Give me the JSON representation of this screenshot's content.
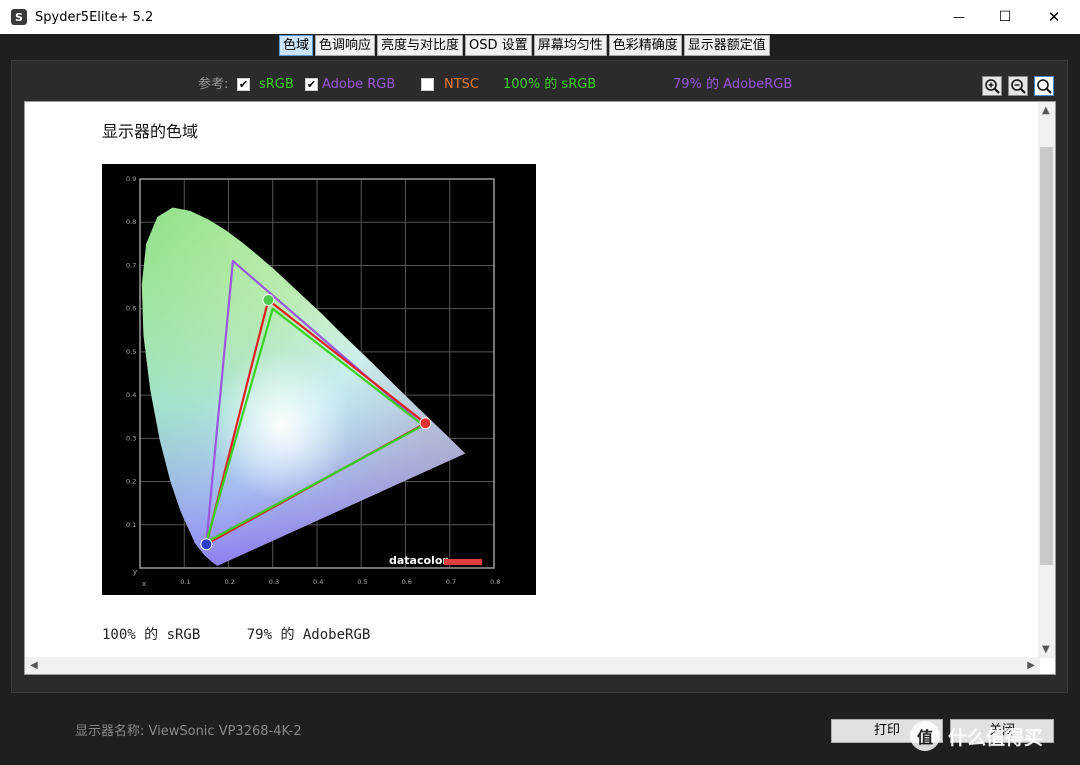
{
  "window": {
    "title": "Spyder5Elite+ 5.2",
    "app_icon": "S",
    "controls": {
      "minimize": "—",
      "maximize": "☐",
      "close": "✕"
    }
  },
  "tabs": [
    {
      "label": "色域",
      "active": true
    },
    {
      "label": "色调响应",
      "active": false
    },
    {
      "label": "亮度与对比度",
      "active": false
    },
    {
      "label": "OSD 设置",
      "active": false
    },
    {
      "label": "屏幕均匀性",
      "active": false
    },
    {
      "label": "色彩精确度",
      "active": false
    },
    {
      "label": "显示器额定值",
      "active": false
    }
  ],
  "reference": {
    "label": "参考:",
    "options": [
      {
        "label": "sRGB",
        "checked": true,
        "color": "#39d11f"
      },
      {
        "label": "Adobe RGB",
        "checked": true,
        "color": "#9a56e0"
      },
      {
        "label": "NTSC",
        "checked": false,
        "color": "#f07a2a"
      }
    ],
    "summary_srgb": "100% 的 sRGB",
    "summary_adobe": "79% 的 AdobeRGB",
    "summary_srgb_color": "#39d11f",
    "summary_adobe_color": "#9a56e0"
  },
  "zoom": {
    "zoom_in_icon": "zoom-in-icon",
    "zoom_out_icon": "zoom-out-icon",
    "zoom_fit_icon": "zoom-fit-icon"
  },
  "report": {
    "title": "显示器的色域",
    "result_srgb": "100% 的 sRGB",
    "result_adobe": "79% 的 AdobeRGB"
  },
  "chart": {
    "logo": "datacolor",
    "x_axis_label": "x",
    "y_axis_label": "y",
    "x_ticks": [
      "0.1",
      "0.2",
      "0.3",
      "0.4",
      "0.5",
      "0.6",
      "0.7",
      "0.8"
    ],
    "y_ticks": [
      "0.1",
      "0.2",
      "0.3",
      "0.4",
      "0.5",
      "0.6",
      "0.7",
      "0.8",
      "0.9"
    ]
  },
  "chart_data": {
    "type": "scatter",
    "x_range": [
      0,
      0.8
    ],
    "y_range": [
      0,
      0.9
    ],
    "grid": true,
    "series": [
      {
        "name": "sRGB",
        "color": "#39d11f",
        "points": [
          [
            0.64,
            0.33
          ],
          [
            0.3,
            0.6
          ],
          [
            0.15,
            0.06
          ]
        ]
      },
      {
        "name": "Adobe RGB",
        "color": "#9a56e0",
        "points": [
          [
            0.64,
            0.33
          ],
          [
            0.21,
            0.71
          ],
          [
            0.15,
            0.06
          ]
        ]
      },
      {
        "name": "",
        "color": "#e02020",
        "points": [
          [
            0.645,
            0.335
          ],
          [
            0.29,
            0.62
          ],
          [
            0.15,
            0.055
          ]
        ]
      }
    ],
    "locus": [
      [
        0.175,
        0.005
      ],
      [
        0.165,
        0.012
      ],
      [
        0.145,
        0.03
      ],
      [
        0.124,
        0.058
      ],
      [
        0.091,
        0.133
      ],
      [
        0.069,
        0.2
      ],
      [
        0.045,
        0.295
      ],
      [
        0.023,
        0.413
      ],
      [
        0.008,
        0.538
      ],
      [
        0.004,
        0.655
      ],
      [
        0.014,
        0.75
      ],
      [
        0.039,
        0.812
      ],
      [
        0.074,
        0.834
      ],
      [
        0.114,
        0.826
      ],
      [
        0.155,
        0.806
      ],
      [
        0.193,
        0.782
      ],
      [
        0.23,
        0.754
      ],
      [
        0.266,
        0.724
      ],
      [
        0.302,
        0.692
      ],
      [
        0.337,
        0.659
      ],
      [
        0.373,
        0.624
      ],
      [
        0.41,
        0.589
      ],
      [
        0.448,
        0.55
      ],
      [
        0.512,
        0.487
      ],
      [
        0.575,
        0.424
      ],
      [
        0.627,
        0.372
      ],
      [
        0.692,
        0.308
      ],
      [
        0.735,
        0.265
      ]
    ]
  },
  "footer": {
    "monitor_label": "显示器名称: ViewSonic VP3268-4K-2",
    "print_button": "打印",
    "close_button": "关闭",
    "watermark_logo": "值",
    "watermark_text": "什么值得买"
  }
}
